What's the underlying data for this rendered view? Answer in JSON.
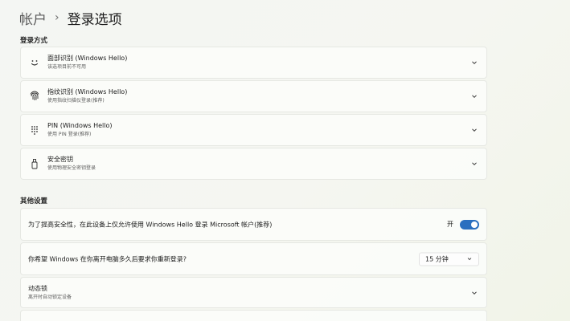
{
  "breadcrumb": {
    "parent": "帐户",
    "separator": "›",
    "current": "登录选项"
  },
  "sections": {
    "sign_in_methods": "登录方式",
    "other_settings": "其他设置"
  },
  "methods": [
    {
      "icon": "face-icon",
      "title": "面部识别 (Windows Hello)",
      "subtitle": "该选项目前不可用"
    },
    {
      "icon": "fingerprint-icon",
      "title": "指纹识别 (Windows Hello)",
      "subtitle": "使用指纹扫描仪登录(推荐)"
    },
    {
      "icon": "pin-keypad-icon",
      "title": "PIN (Windows Hello)",
      "subtitle": "使用 PIN 登录(推荐)"
    },
    {
      "icon": "security-key-icon",
      "title": "安全密钥",
      "subtitle": "使用物理安全密钥登录"
    }
  ],
  "other": {
    "hello_only": {
      "label": "为了提高安全性，在此设备上仅允许使用 Windows Hello 登录 Microsoft 帐户(推荐)",
      "state": "开",
      "on": true
    },
    "away_time": {
      "label": "你希望 Windows 在你离开电脑多久后要求你重新登录?",
      "value": "15 分钟"
    },
    "dynamic_lock": {
      "title": "动态锁",
      "subtitle": "离开时自动锁定设备"
    }
  },
  "colors": {
    "accent": "#2a6fbf"
  }
}
